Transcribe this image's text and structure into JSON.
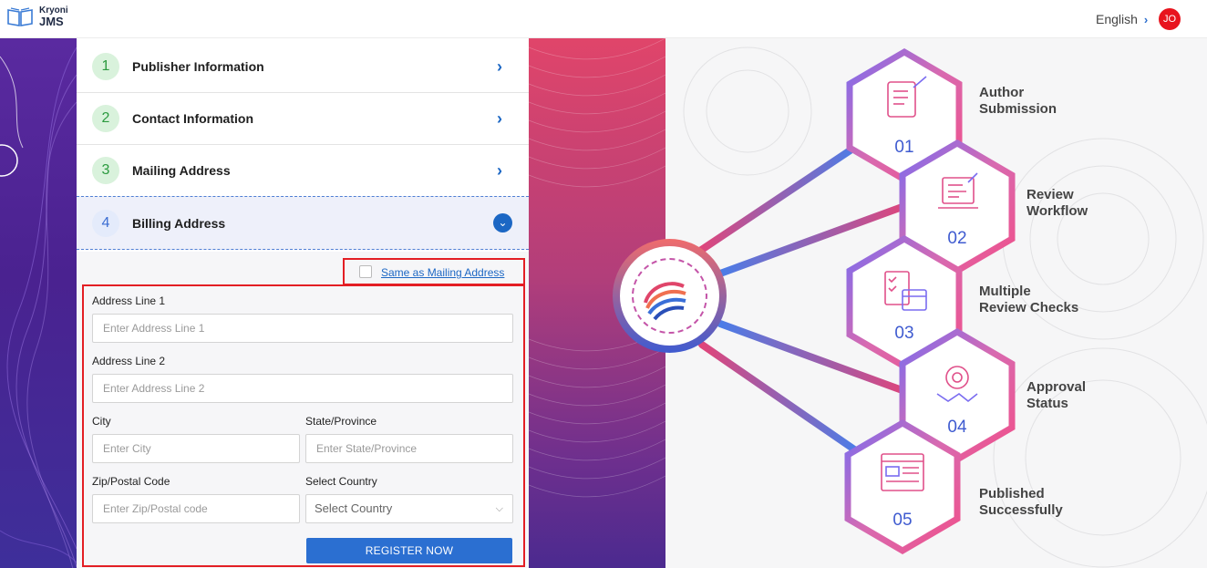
{
  "header": {
    "logo_line1": "Kryoni",
    "logo_line2": "JMS",
    "language": "English",
    "avatar_initials": "JO"
  },
  "steps": [
    {
      "number": "1",
      "label": "Publisher Information"
    },
    {
      "number": "2",
      "label": "Contact Information"
    },
    {
      "number": "3",
      "label": "Mailing Address"
    },
    {
      "number": "4",
      "label": "Billing Address"
    }
  ],
  "billing": {
    "same_as_mailing_label": "Same as Mailing Address",
    "address1_label": "Address Line 1",
    "address1_placeholder": "Enter Address Line 1",
    "address2_label": "Address Line 2",
    "address2_placeholder": "Enter Address Line 2",
    "city_label": "City",
    "city_placeholder": "Enter City",
    "state_label": "State/Province",
    "state_placeholder": "Enter State/Province",
    "zip_label": "Zip/Postal Code",
    "zip_placeholder": "Enter Zip/Postal code",
    "country_label": "Select Country",
    "country_value": "Select Country",
    "register_label": "REGISTER NOW"
  },
  "workflow": [
    {
      "number": "01",
      "line1": "Author",
      "line2": "Submission"
    },
    {
      "number": "02",
      "line1": "Review",
      "line2": "Workflow"
    },
    {
      "number": "03",
      "line1": "Multiple",
      "line2": "Review Checks"
    },
    {
      "number": "04",
      "line1": "Approval",
      "line2": "Status"
    },
    {
      "number": "05",
      "line1": "Published",
      "line2": "Successfully"
    }
  ],
  "colors": {
    "accent": "#1c67c4",
    "highlight_border": "#e31e24",
    "hex_gradient_start": "#f0508a",
    "hex_gradient_end": "#5d6ee8"
  }
}
